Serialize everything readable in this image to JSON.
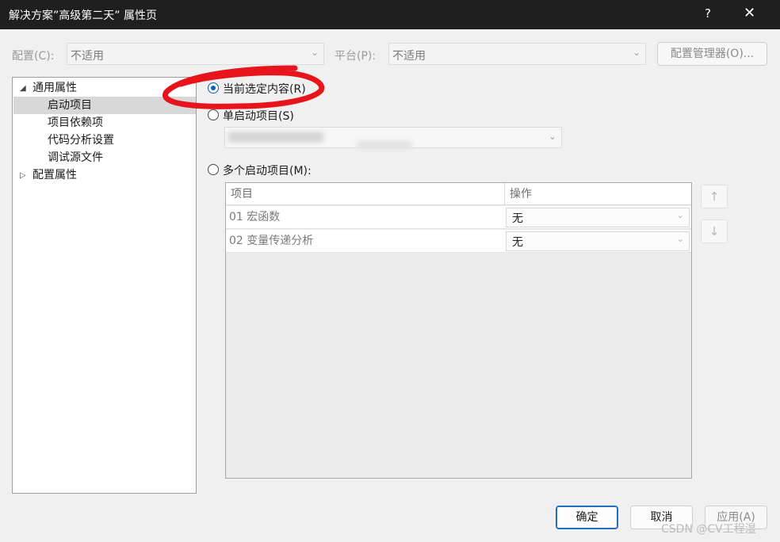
{
  "window": {
    "title": "解决方案”高级第二天” 属性页",
    "help_glyph": "?",
    "close_glyph": "✕"
  },
  "config_bar": {
    "config_label": "配置(C):",
    "config_value": "不适用",
    "platform_label": "平台(P):",
    "platform_value": "不适用",
    "manager_button": "配置管理器(O)..."
  },
  "tree": {
    "items": [
      {
        "label": "通用属性",
        "expander": "◢"
      },
      {
        "label": "启动项目",
        "selected": true
      },
      {
        "label": "项目依赖项"
      },
      {
        "label": "代码分析设置"
      },
      {
        "label": "调试源文件"
      },
      {
        "label": "配置属性",
        "expander": "▷"
      }
    ]
  },
  "startup": {
    "current_selection": "当前选定内容(R)",
    "single_project": "单启动项目(S)",
    "multiple_projects": "多个启动项目(M):"
  },
  "grid": {
    "columns": [
      "项目",
      "操作"
    ],
    "rows": [
      {
        "project": "01 宏函数",
        "action": "无"
      },
      {
        "project": "02 变量传递分析",
        "action": "无"
      }
    ]
  },
  "move_buttons": {
    "up_icon": "↑",
    "down_icon": "↓"
  },
  "footer": {
    "ok": "确定",
    "cancel": "取消",
    "apply": "应用(A)"
  },
  "watermark": "CSDN @CV工程湿",
  "colors": {
    "titlebar": "#1f1f1f",
    "accent": "#0a5fb4",
    "annotation_red": "#e8141c"
  }
}
